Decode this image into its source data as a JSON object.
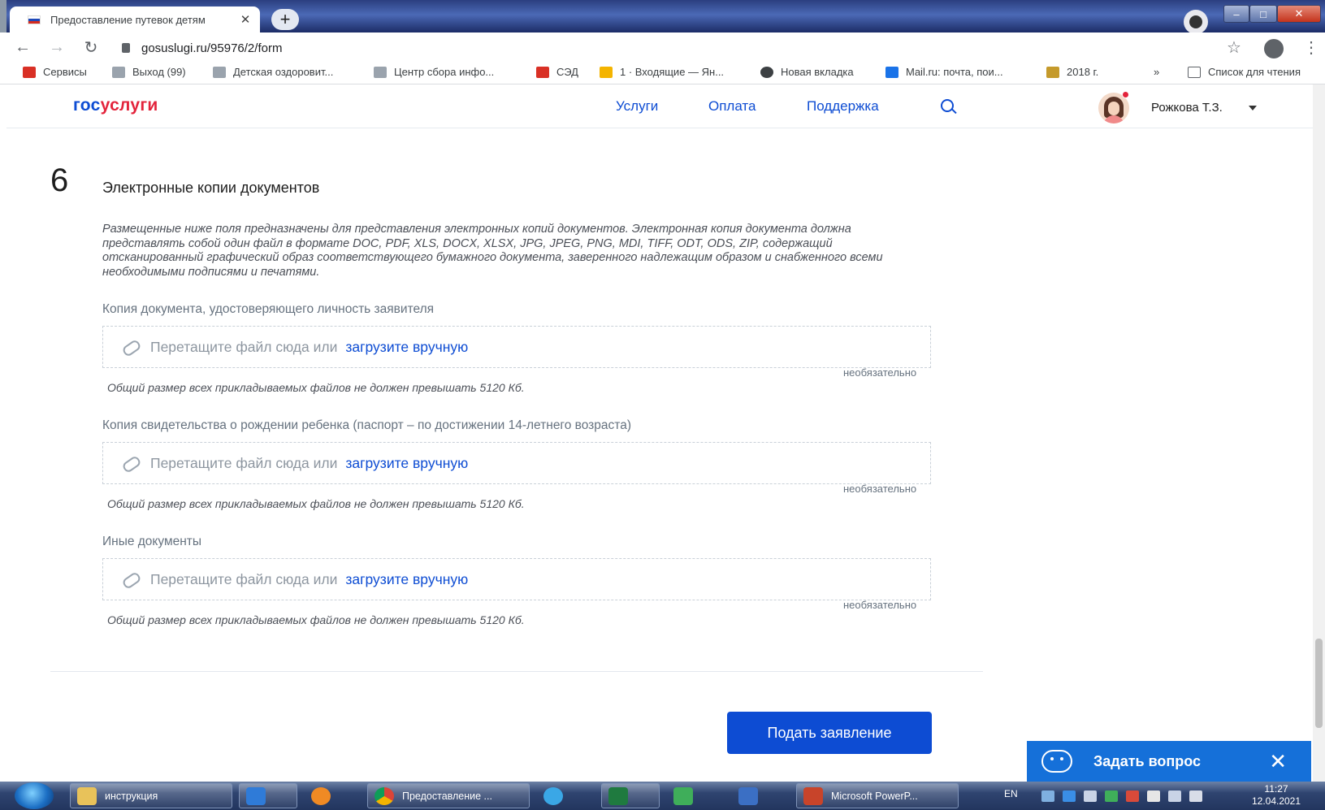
{
  "browser": {
    "tab_title": "Предоставление путевок детям",
    "tab_close": "✕",
    "new_tab": "+",
    "url": "gosuslugi.ru/95976/2/form",
    "bookmarks": [
      {
        "label": "Сервисы",
        "color": "#d93025"
      },
      {
        "label": "Выход (99)",
        "color": "#9aa3ad"
      },
      {
        "label": "Детская оздоровит...",
        "color": "#9aa3ad"
      },
      {
        "label": "Центр сбора инфо...",
        "color": "#9aa3ad"
      },
      {
        "label": "СЭД",
        "color": "#d93025"
      },
      {
        "label": "1 · Входящие — Ян...",
        "color": "#f4b400"
      },
      {
        "label": "Новая вкладка",
        "color": "#3c4043"
      },
      {
        "label": "Mail.ru: почта, пои...",
        "color": "#1a73e8"
      },
      {
        "label": "2018 г.",
        "color": "#c59a2b"
      }
    ],
    "bookmarks_more": "»",
    "reading_list": "Список для чтения"
  },
  "site": {
    "logo_part1": "гос",
    "logo_part2": "услуги",
    "nav": [
      "Услуги",
      "Оплата",
      "Поддержка"
    ],
    "user_name": "Рожкова Т.З."
  },
  "form": {
    "step_number": "6",
    "step_title": "Электронные копии документов",
    "intro": "Размещенные ниже поля предназначены для представления электронных копий документов. Электронная копия документа должна представлять собой один файл в формате DOC, PDF, XLS, DOCX, XLSX, JPG, JPEG, PNG, MDI, TIFF, ODT, ODS, ZIP, содержащий отсканированный графический образ соответствующего бумажного документа, заверенного надлежащим образом и снабженного всеми необходимыми подписями и печатями.",
    "fields": [
      {
        "label": "Копия документа, удостоверяющего личность заявителя",
        "hint": "Перетащите файл сюда или",
        "upload_link": "загрузите вручную",
        "optional": "необязательно",
        "limit": "Общий размер всех прикладываемых файлов не должен превышать 5120 Кб."
      },
      {
        "label": "Копия свидетельства о рождении ребенка (паспорт – по достижении 14-летнего возраста)",
        "hint": "Перетащите файл сюда или",
        "upload_link": "загрузите вручную",
        "optional": "необязательно",
        "limit": "Общий размер всех прикладываемых файлов не должен превышать 5120 Кб."
      },
      {
        "label": "Иные документы",
        "hint": "Перетащите файл сюда или",
        "upload_link": "загрузите вручную",
        "optional": "необязательно",
        "limit": "Общий размер всех прикладываемых файлов не должен превышать 5120 Кб."
      }
    ],
    "submit_label": "Подать заявление"
  },
  "ask_widget": {
    "label": "Задать вопрос",
    "close": "✕"
  },
  "taskbar": {
    "items": [
      {
        "label": "инструкция",
        "icon": "folder-icon"
      },
      {
        "label": "",
        "icon": "media-player-icon"
      },
      {
        "label": "",
        "icon": "firefox-icon"
      },
      {
        "label": "Предоставление ...",
        "icon": "chrome-icon"
      },
      {
        "label": "",
        "icon": "internet-explorer-icon"
      },
      {
        "label": "",
        "icon": "excel-icon"
      },
      {
        "label": "",
        "icon": "spreadsheet-icon"
      },
      {
        "label": "",
        "icon": "writer-icon"
      },
      {
        "label": "Microsoft PowerP...",
        "icon": "powerpoint-icon"
      }
    ],
    "language": "EN",
    "time": "11:27",
    "date": "12.04.2021"
  },
  "colors": {
    "brand_blue": "#0d4cd3",
    "brand_red": "#e3233b",
    "ask_blue": "#1570d9"
  }
}
